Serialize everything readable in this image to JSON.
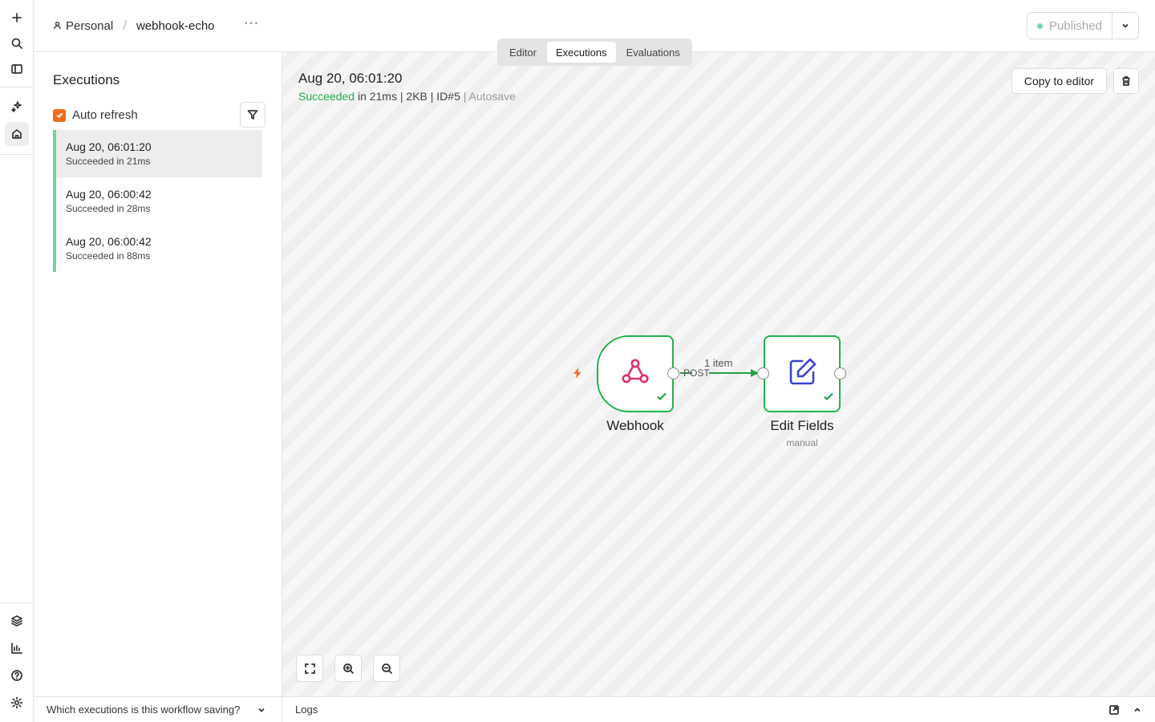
{
  "rail": {
    "items": [
      {
        "icon": "plus-icon"
      },
      {
        "icon": "search-icon"
      },
      {
        "icon": "sidebar-toggle-icon"
      },
      {
        "icon": "sparkles-icon"
      },
      {
        "icon": "home-icon"
      },
      {
        "icon": "templates-icon"
      },
      {
        "icon": "insights-icon"
      },
      {
        "icon": "help-icon"
      },
      {
        "icon": "settings-icon"
      }
    ]
  },
  "header": {
    "project": "Personal",
    "separator": "/",
    "workflow_name": "webhook-echo",
    "more_label": "···",
    "published_label": "Published"
  },
  "tabs": [
    {
      "label": "Editor",
      "active": false
    },
    {
      "label": "Executions",
      "active": true
    },
    {
      "label": "Evaluations",
      "active": false
    }
  ],
  "executions_panel": {
    "title": "Executions",
    "auto_refresh_label": "Auto refresh",
    "auto_refresh_checked": true,
    "items": [
      {
        "time": "Aug 20, 06:01:20",
        "status": "Succeeded in 21ms",
        "active": true
      },
      {
        "time": "Aug 20, 06:00:42",
        "status": "Succeeded in 28ms",
        "active": false
      },
      {
        "time": "Aug 20, 06:00:42",
        "status": "Succeeded in 88ms",
        "active": false
      }
    ],
    "saving_question": "Which executions is this workflow saving?"
  },
  "execution_detail": {
    "title": "Aug 20, 06:01:20",
    "status": "Succeeded",
    "duration": "in 21ms",
    "sep1": "|",
    "size": "2KB",
    "sep2": "|",
    "id": "ID#5",
    "sep3": "|",
    "mode": "Autosave",
    "copy_button": "Copy to editor"
  },
  "workflow": {
    "nodes": [
      {
        "name": "Webhook",
        "subtitle": "",
        "icon": "webhook-icon"
      },
      {
        "name": "Edit Fields",
        "subtitle": "manual",
        "icon": "edit-icon"
      }
    ],
    "connection": {
      "output_label": "POST",
      "items_label": "1 item"
    }
  },
  "logs": {
    "label": "Logs"
  },
  "colors": {
    "success": "#22b14c",
    "accent": "#f26b1d",
    "webhook_icon": "#e0336b",
    "edit_icon": "#3b3fd8"
  }
}
